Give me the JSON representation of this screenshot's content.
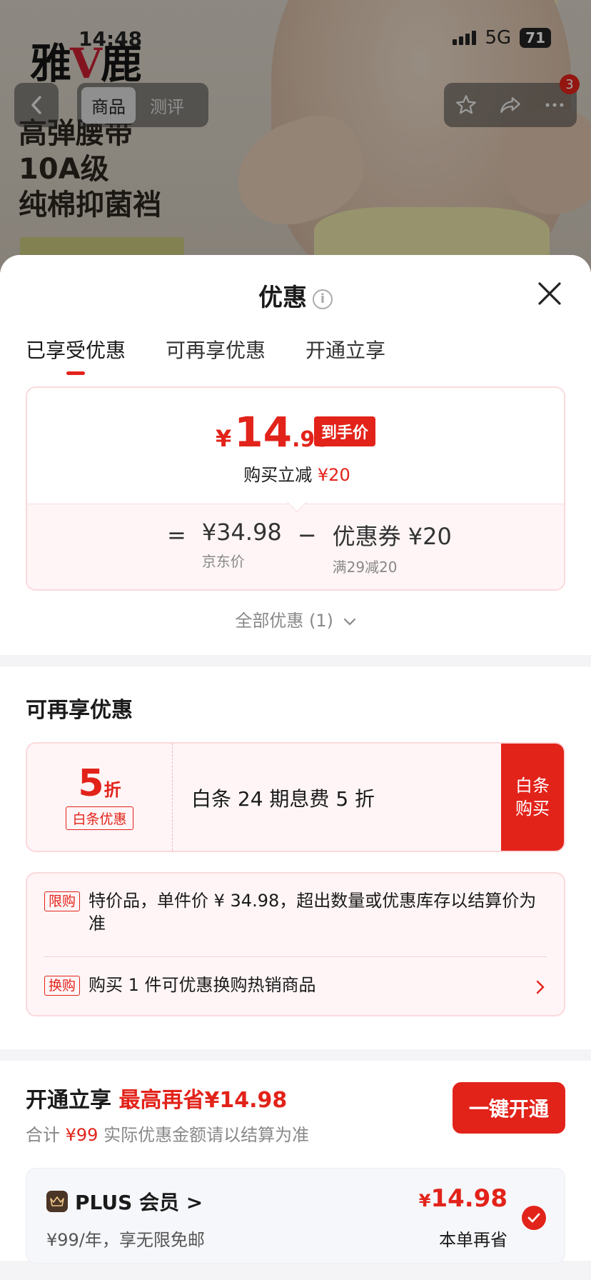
{
  "background": {
    "brand": "雅鹿",
    "status_bar": {
      "time": "14:48",
      "network": "5G",
      "battery": "71"
    },
    "tagline": [
      "高弹腰带",
      "10A级",
      "纯棉抑菌裆"
    ],
    "nav": {
      "tab_product": "商品",
      "tab_review": "测评",
      "more_badge": "3"
    }
  },
  "sheet": {
    "title": "优惠",
    "tabs": [
      "已享受优惠",
      "可再享优惠",
      "开通立享"
    ],
    "final_price": {
      "currency": "¥",
      "integer": "14",
      "decimal": ".98",
      "tag": "到手价"
    },
    "reduce": {
      "label": "购买立减",
      "amount": "¥20"
    },
    "formula": {
      "eq": "=",
      "jd_price": "¥34.98",
      "jd_price_label": "京东价",
      "minus": "−",
      "coupon": "优惠券 ¥20",
      "coupon_rule": "满29减20"
    },
    "all_promos": "全部优惠 (1)"
  },
  "more_promos": {
    "title": "可再享优惠",
    "baitiao": {
      "discount_num": "5",
      "discount_unit": "折",
      "label": "白条优惠",
      "desc": "白条 24 期息费 5 折",
      "button": "白条购买"
    },
    "rules": [
      {
        "chip": "限购",
        "text": "特价品，单件价 ¥ 34.98，超出数量或优惠库存以结算价为准"
      },
      {
        "chip": "换购",
        "text": "购买 1 件可优惠换购热销商品"
      }
    ]
  },
  "open": {
    "title": "开通立享",
    "highlight": "最高再省¥14.98",
    "sub_prefix": "合计",
    "sub_amount": "¥99",
    "sub_suffix": "实际优惠金额请以结算为准",
    "button": "一键开通",
    "plus": {
      "name": "PLUS 会员 >",
      "desc": "¥99/年，享无限免邮",
      "price_currency": "¥",
      "price": "14.98",
      "save_label": "本单再省"
    }
  },
  "colors": {
    "accent": "#e2231a",
    "border_pink": "#fbd9dc",
    "bg_pink": "#fff5f6"
  }
}
